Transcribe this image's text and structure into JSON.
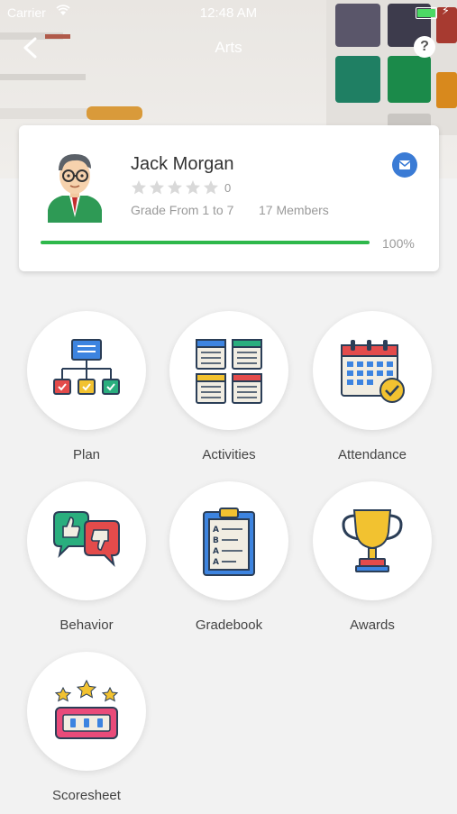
{
  "status_bar": {
    "carrier": "Carrier",
    "time": "12:48 AM"
  },
  "nav": {
    "title": "Arts"
  },
  "card": {
    "name": "Jack Morgan",
    "rating_count": "0",
    "rating": 0,
    "grade": "Grade From 1 to 7",
    "members": "17 Members",
    "progress": 100,
    "progress_label": "100%"
  },
  "menu": [
    {
      "label": "Plan",
      "icon": "plan-icon"
    },
    {
      "label": "Activities",
      "icon": "activities-icon"
    },
    {
      "label": "Attendance",
      "icon": "attendance-icon"
    },
    {
      "label": "Behavior",
      "icon": "behavior-icon"
    },
    {
      "label": "Gradebook",
      "icon": "gradebook-icon"
    },
    {
      "label": "Awards",
      "icon": "awards-icon"
    },
    {
      "label": "Scoresheet",
      "icon": "scoresheet-icon"
    }
  ],
  "colors": {
    "accent": "#3a7bd5",
    "progress": "#2eb84b"
  }
}
